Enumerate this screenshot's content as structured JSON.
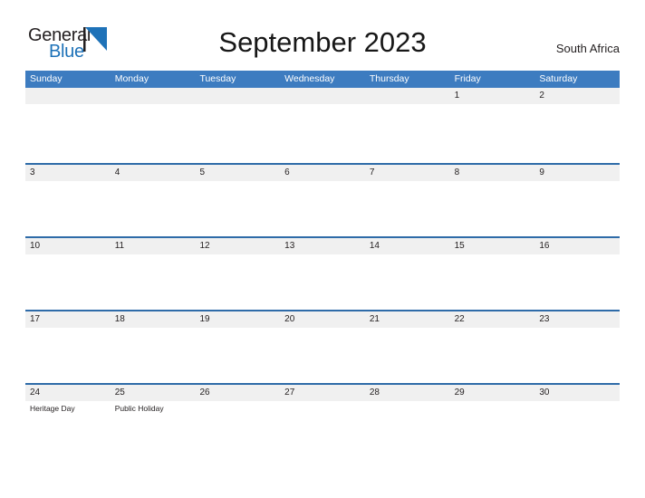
{
  "brand": {
    "name_part1": "General",
    "name_part2": "Blue",
    "flag_icon": "blue-triangle-flag-icon",
    "color_dark": "#231f20",
    "color_blue": "#1e72b8"
  },
  "header": {
    "title": "September 2023",
    "region": "South Africa"
  },
  "theme": {
    "header_blue": "#3d7cc0",
    "rule_blue": "#2e6ba8",
    "band_gray": "#f0f0f0",
    "text_dark": "#231f20",
    "page_background": "#ffffff"
  },
  "calendar": {
    "month": "September",
    "year": "2023",
    "weekday_headers": [
      "Sunday",
      "Monday",
      "Tuesday",
      "Wednesday",
      "Thursday",
      "Friday",
      "Saturday"
    ],
    "weeks": [
      [
        {
          "day": "",
          "event": ""
        },
        {
          "day": "",
          "event": ""
        },
        {
          "day": "",
          "event": ""
        },
        {
          "day": "",
          "event": ""
        },
        {
          "day": "",
          "event": ""
        },
        {
          "day": "1",
          "event": ""
        },
        {
          "day": "2",
          "event": ""
        }
      ],
      [
        {
          "day": "3",
          "event": ""
        },
        {
          "day": "4",
          "event": ""
        },
        {
          "day": "5",
          "event": ""
        },
        {
          "day": "6",
          "event": ""
        },
        {
          "day": "7",
          "event": ""
        },
        {
          "day": "8",
          "event": ""
        },
        {
          "day": "9",
          "event": ""
        }
      ],
      [
        {
          "day": "10",
          "event": ""
        },
        {
          "day": "11",
          "event": ""
        },
        {
          "day": "12",
          "event": ""
        },
        {
          "day": "13",
          "event": ""
        },
        {
          "day": "14",
          "event": ""
        },
        {
          "day": "15",
          "event": ""
        },
        {
          "day": "16",
          "event": ""
        }
      ],
      [
        {
          "day": "17",
          "event": ""
        },
        {
          "day": "18",
          "event": ""
        },
        {
          "day": "19",
          "event": ""
        },
        {
          "day": "20",
          "event": ""
        },
        {
          "day": "21",
          "event": ""
        },
        {
          "day": "22",
          "event": ""
        },
        {
          "day": "23",
          "event": ""
        }
      ],
      [
        {
          "day": "24",
          "event": "Heritage Day"
        },
        {
          "day": "25",
          "event": "Public Holiday"
        },
        {
          "day": "26",
          "event": ""
        },
        {
          "day": "27",
          "event": ""
        },
        {
          "day": "28",
          "event": ""
        },
        {
          "day": "29",
          "event": ""
        },
        {
          "day": "30",
          "event": ""
        }
      ]
    ]
  }
}
